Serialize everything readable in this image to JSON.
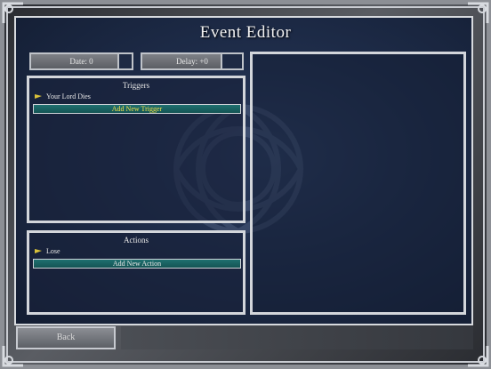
{
  "window": {
    "title": "Event Editor"
  },
  "top_buttons": {
    "date_label": "Date: 0",
    "delay_label": "Delay: +0"
  },
  "triggers": {
    "title": "Triggers",
    "items": [
      "Your Lord Dies"
    ],
    "add_label": "Add New Trigger"
  },
  "actions": {
    "title": "Actions",
    "items": [
      "Lose"
    ],
    "add_label": "Add New Action"
  },
  "footer": {
    "back_label": "Back"
  },
  "colors": {
    "panel_bg": "#1e2c49",
    "add_bar": "#1f6f6f",
    "trigger_text": "#f4e24a",
    "border": "#d3d6db"
  }
}
